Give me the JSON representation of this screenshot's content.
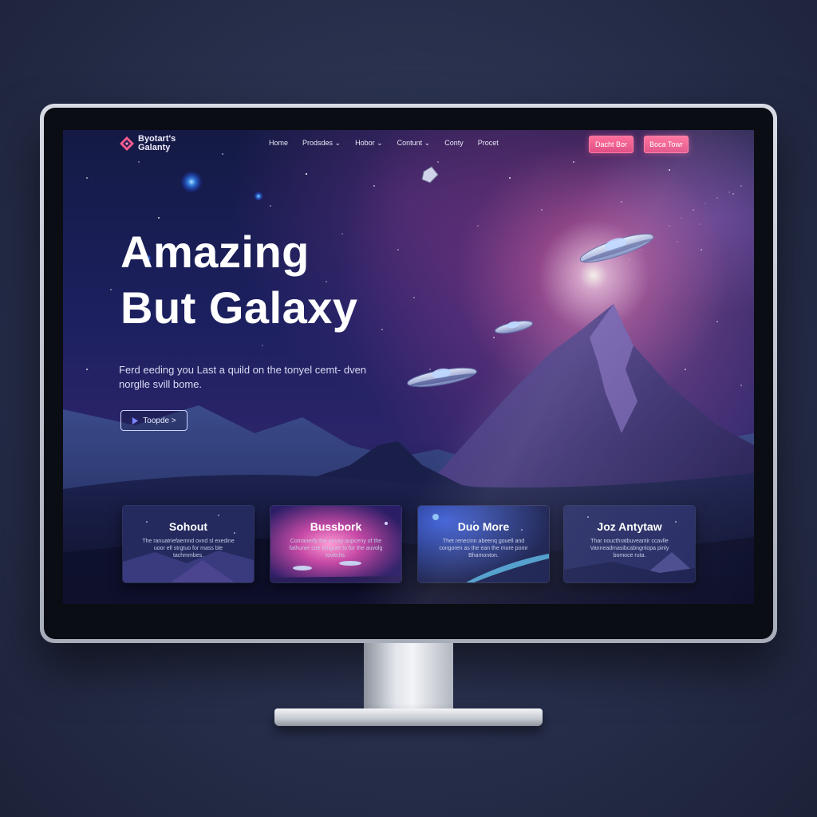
{
  "site": {
    "logo_text": "Byotart's Galanty"
  },
  "nav": {
    "items": [
      {
        "label": "Home"
      },
      {
        "label": "Prodsdes ⌄"
      },
      {
        "label": "Hobor ⌄"
      },
      {
        "label": "Contunt ⌄"
      },
      {
        "label": "Conty"
      },
      {
        "label": "Procet"
      }
    ],
    "button_primary": "Dacht Bor",
    "button_secondary": "Boca Towr"
  },
  "hero": {
    "title_line1": "Amazing",
    "title_line2": "But Galaxy",
    "subtitle": "Ferd eeding you Last a quild on the tonyel cemt- dven norglle svill bome.",
    "cta_label": "Toopde >"
  },
  "cards": [
    {
      "title": "Sohout",
      "text": "The ranuatriefaemnd ovnd sl exedine uoor ell strgtuo for mass ble tachmmbes."
    },
    {
      "title": "Bussbork",
      "text": "Comanerfy the anvay aupceny of the fathuner cne tonguer to for the auvolg tovitchs."
    },
    {
      "title": "Duo More",
      "text": "Thet renecinn abeenq gouell and congoren as the ean the more pomr Bhamonton."
    },
    {
      "title": "Joz Antytaw",
      "text": "Thar noucthratbuveantir ccavlle Vanneadmasibcabngnlopa pinly bomoce ruta."
    }
  ],
  "colors": {
    "accent": "#ff6f9c",
    "hero_text": "#ffffff",
    "screen_bg": "#1c2060"
  },
  "icons": {
    "logo": "diamond-logo-icon",
    "cta": "play-icon"
  }
}
